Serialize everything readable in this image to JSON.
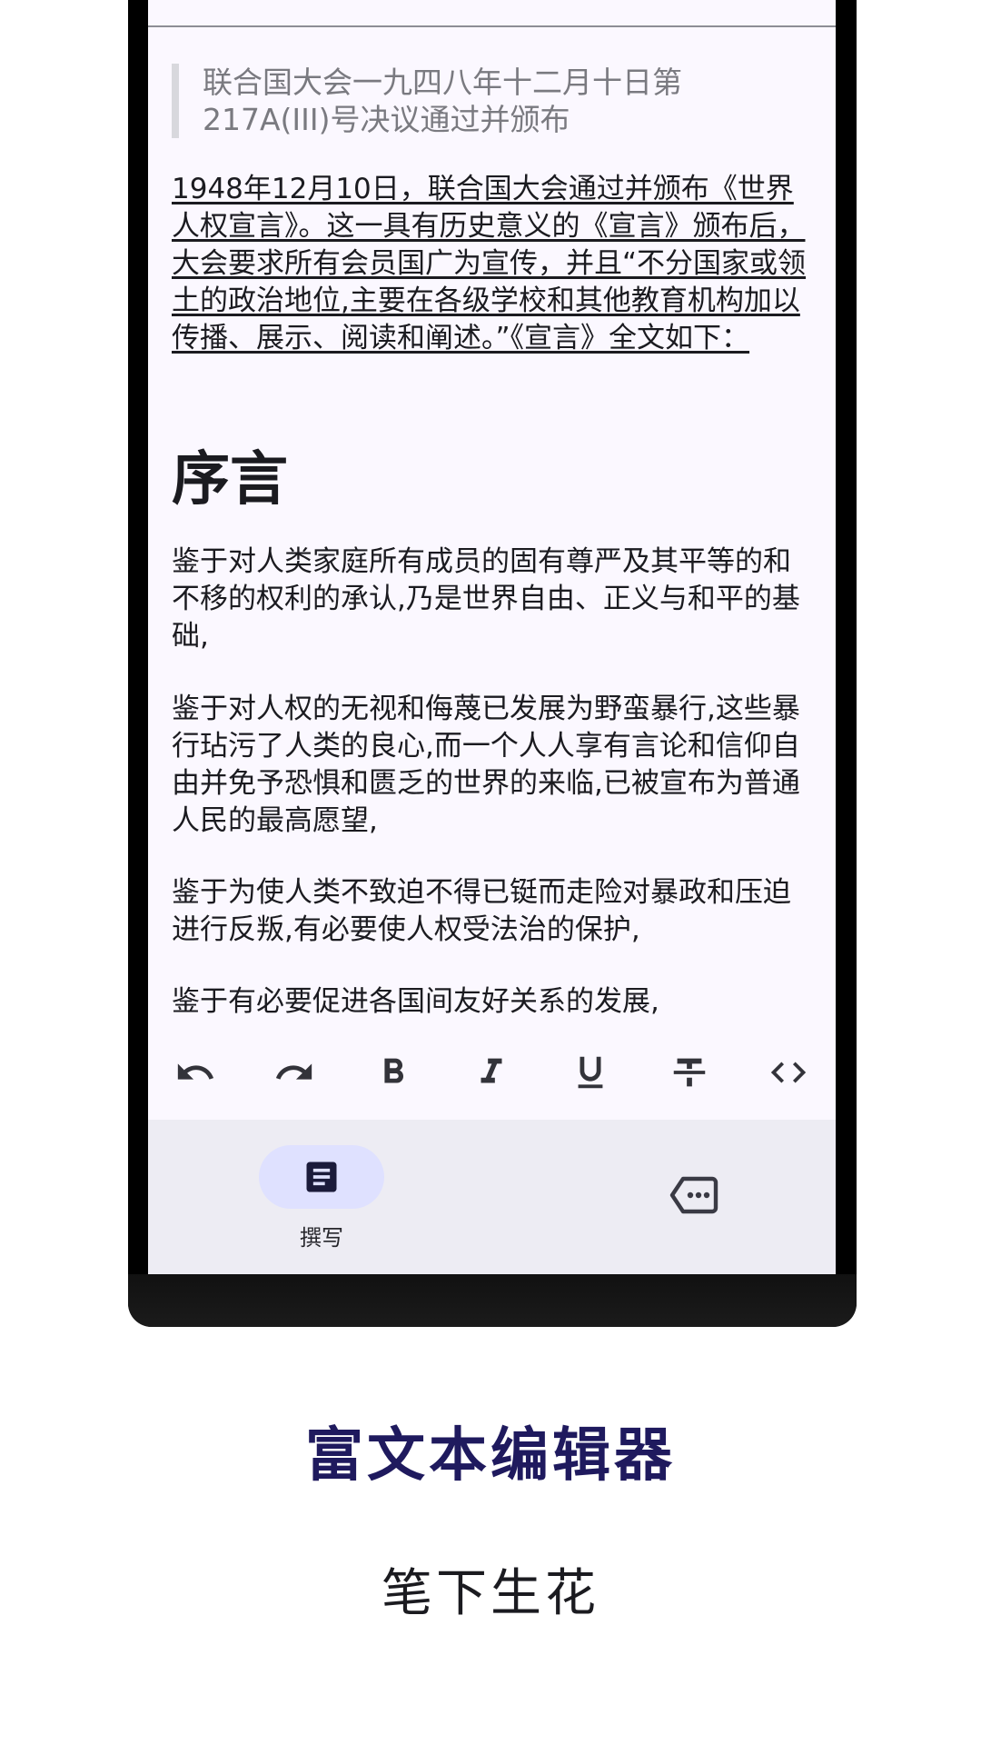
{
  "editor": {
    "quote": "联合国大会一九四八年十二月十日第217A(III)号决议通过并颁布",
    "intro": "1948年12月10日，联合国大会通过并颁布《世界人权宣言》。这一具有历史意义的《宣言》颁布后，大会要求所有会员国广为宣传，并且“不分国家或领土的政治地位,主要在各级学校和其他教育机构加以传播、展示、阅读和阐述。”《宣言》全文如下：",
    "heading": "序言",
    "paragraphs": [
      "鉴于对人类家庭所有成员的固有尊严及其平等的和不移的权利的承认,乃是世界自由、正义与和平的基础,",
      "鉴于对人权的无视和侮蔑已发展为野蛮暴行,这些暴行玷污了人类的良心,而一个人人享有言论和信仰自由并免予恐惧和匮乏的世界的来临,已被宣布为普通人民的最高愿望,",
      "鉴于为使人类不致迫不得已铤而走险对暴政和压迫进行反叛,有必要使人权受法治的保护,",
      "鉴于有必要促进各国间友好关系的发展,"
    ]
  },
  "toolbar": {
    "icons": [
      "undo-icon",
      "redo-icon",
      "bold-icon",
      "italic-icon",
      "underline-icon",
      "strikethrough-icon",
      "code-icon"
    ]
  },
  "nav": {
    "compose_label": "撰写",
    "compose_icon": "article-icon",
    "tags_icon": "label-icon"
  },
  "caption": {
    "title": "富文本编辑器",
    "subtitle": "笔下生花"
  },
  "colors": {
    "accent_pill": "#dfe1ff",
    "title_color": "#1f1a5e"
  }
}
